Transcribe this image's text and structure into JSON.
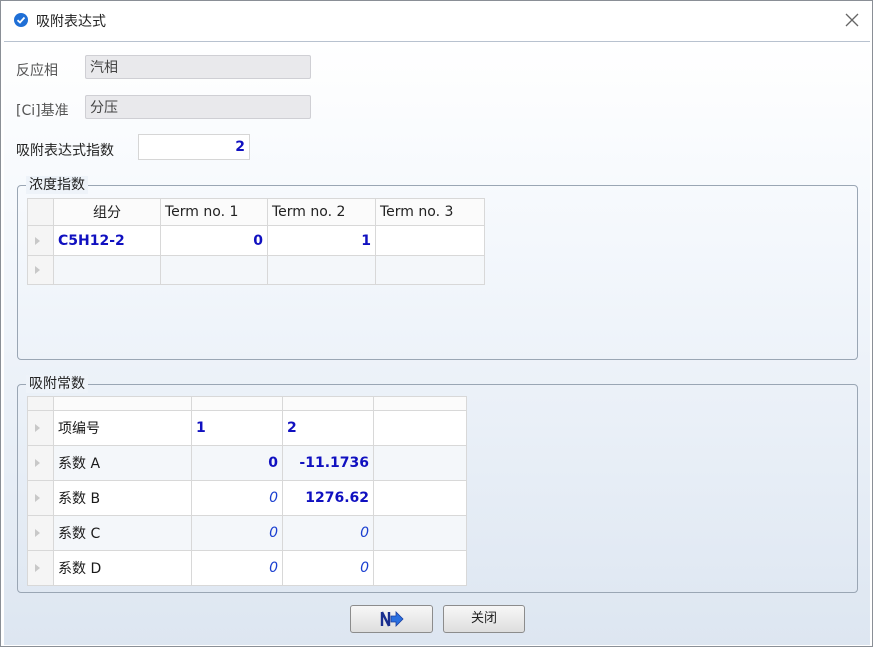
{
  "window": {
    "title": "吸附表达式"
  },
  "form": {
    "phase_label": "反应相",
    "phase_value": "汽相",
    "basis_label": "[Ci]基准",
    "basis_value": "分压",
    "exponent_label": "吸附表达式指数",
    "exponent_value": "2"
  },
  "conc": {
    "group_title": "浓度指数",
    "headers": [
      "组分",
      "Term no. 1",
      "Term no. 2",
      "Term no. 3"
    ],
    "rows": [
      [
        "C5H12-2",
        "0",
        "1",
        ""
      ]
    ]
  },
  "ads": {
    "group_title": "吸附常数",
    "rows": [
      [
        "项编号",
        "1",
        "2",
        ""
      ],
      [
        "系数 A",
        "0",
        "-11.1736",
        ""
      ],
      [
        "系数 B",
        "0",
        "1276.62",
        ""
      ],
      [
        "系数 C",
        "0",
        "0",
        ""
      ],
      [
        "系数 D",
        "0",
        "0",
        ""
      ]
    ]
  },
  "buttons": {
    "next_icon": "next-arrow-icon",
    "close_label": "关闭"
  },
  "colors": {
    "accent": "#1f6fd6",
    "value_text": "#1010c0"
  }
}
